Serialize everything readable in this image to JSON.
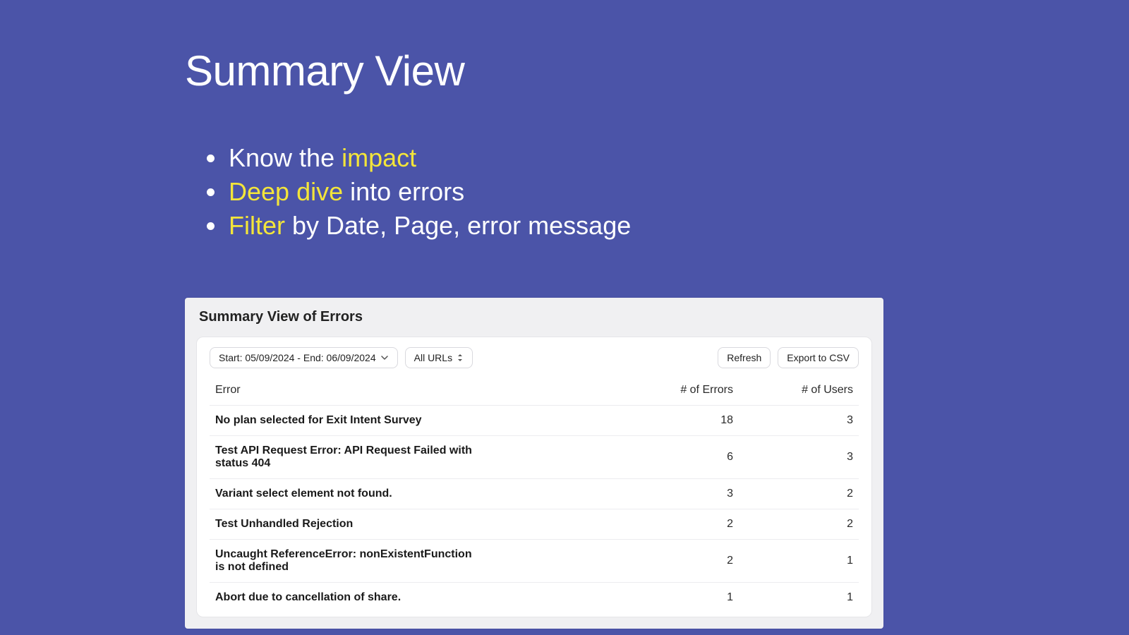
{
  "slide": {
    "title": "Summary View",
    "bullets": [
      {
        "pre": "Know the ",
        "hl": "impact",
        "post": ""
      },
      {
        "pre": "",
        "hl": "Deep dive",
        "post": " into errors"
      },
      {
        "pre": "",
        "hl": "Filter",
        "post": " by Date, Page, error message"
      }
    ]
  },
  "panel": {
    "title": "Summary View of Errors",
    "toolbar": {
      "date_range_label": "Start: 05/09/2024 - End: 06/09/2024",
      "url_filter_label": "All URLs",
      "refresh_label": "Refresh",
      "export_label": "Export to CSV"
    },
    "columns": {
      "error": "Error",
      "count": "# of Errors",
      "users": "# of Users"
    },
    "rows": [
      {
        "error": "No plan selected for Exit Intent Survey",
        "count": "18",
        "users": "3"
      },
      {
        "error": "Test API Request Error: API Request Failed with status 404",
        "count": "6",
        "users": "3"
      },
      {
        "error": "Variant select element not found.",
        "count": "3",
        "users": "2"
      },
      {
        "error": "Test Unhandled Rejection",
        "count": "2",
        "users": "2"
      },
      {
        "error": "Uncaught ReferenceError: nonExistentFunction is not defined",
        "count": "2",
        "users": "1"
      },
      {
        "error": "Abort due to cancellation of share.",
        "count": "1",
        "users": "1"
      }
    ]
  }
}
